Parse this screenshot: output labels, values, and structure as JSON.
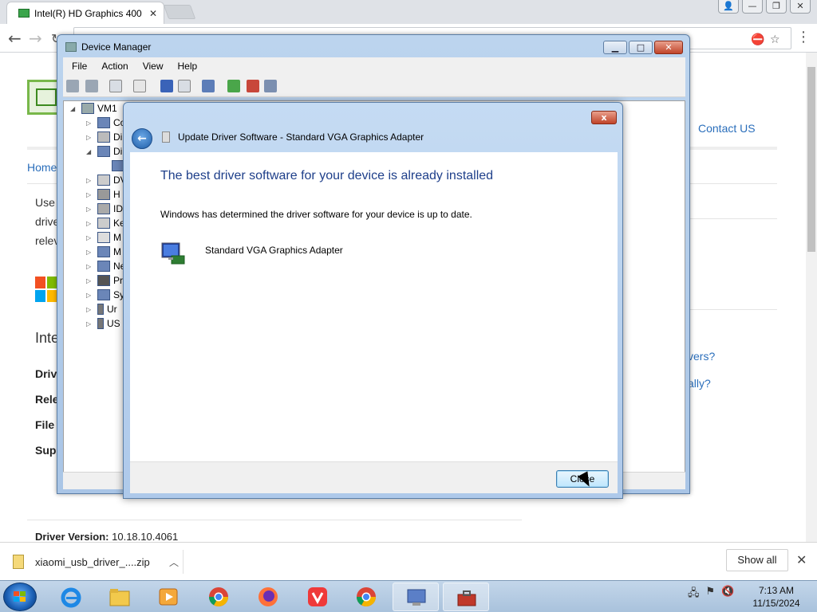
{
  "browser": {
    "tab_title": "Intel(R) HD Graphics 400",
    "tab_close": "✕",
    "back_icon": "arrow-left-icon",
    "forward_icon": "arrow-right-icon",
    "address_visible": ""
  },
  "page": {
    "contact": "Contact US",
    "home": "Home",
    "intro_lines": [
      "Use",
      "drive",
      "relev"
    ],
    "heading": "Intel",
    "fields": [
      "Drive",
      "Rele",
      "File S",
      "Supp"
    ],
    "right_links": [
      "vers?",
      "ally?"
    ],
    "driver_version_label": "Driver Version:",
    "driver_version_value": "10.18.10.4061"
  },
  "device_manager": {
    "title": "Device Manager",
    "menu": [
      "File",
      "Action",
      "View",
      "Help"
    ],
    "tree": {
      "root": "VM1",
      "items": [
        "Co",
        "Di",
        "Di",
        "",
        "DV",
        "H",
        "ID",
        "Ke",
        "M",
        "M",
        "Ne",
        "Pr",
        "Sy",
        "Ur",
        "US"
      ]
    }
  },
  "update_dialog": {
    "header": "Update Driver Software - Standard VGA Graphics Adapter",
    "heading": "The best driver software for your device is already installed",
    "message": "Windows has determined the driver software for your device is up to date.",
    "device_name": "Standard VGA Graphics Adapter",
    "close_button": "Close",
    "close_x": "x"
  },
  "downloads": {
    "file_name": "xiaomi_usb_driver_....zip",
    "show_all": "Show all"
  },
  "taskbar": {
    "time": "7:13 AM",
    "date": "11/15/2024"
  }
}
